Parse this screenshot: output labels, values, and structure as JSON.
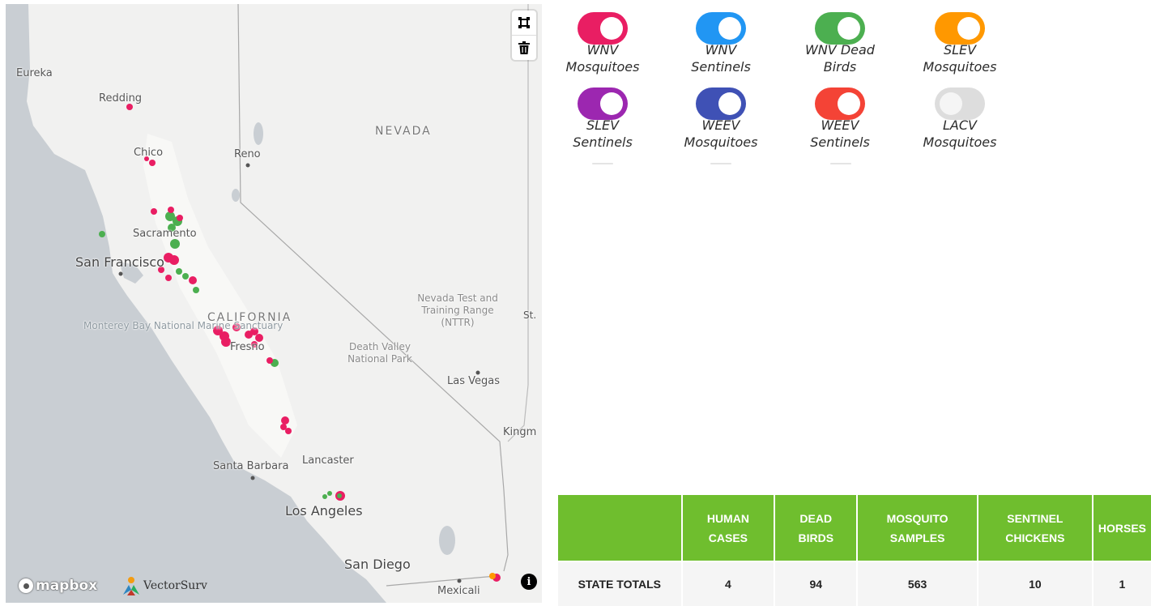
{
  "map": {
    "places": {
      "eureka": "Eureka",
      "redding": "Redding",
      "chico": "Chico",
      "reno": "Reno",
      "nevada": "NEVADA",
      "sacramento": "Sacramento",
      "san_francisco": "San Francisco",
      "california": "CALIFORNIA",
      "fresno": "Fresno",
      "monterey": "Monterey Bay National Marine Sanctuary",
      "nevada_test": "Nevada Test and Training Range (NTTR)",
      "st": "St.",
      "death_valley": "Death Valley National Park",
      "las_vegas": "Las Vegas",
      "kingman": "Kingm",
      "santa_barbara": "Santa Barbara",
      "lancaster": "Lancaster",
      "los_angeles": "Los Angeles",
      "san_diego": "San Diego",
      "mexicali": "Mexicali"
    },
    "attribution": {
      "mapbox": "mapbox",
      "vectorsurv": "VectorSurv"
    },
    "controls": {
      "polygon": "polygon-draw-icon",
      "trash": "trash-icon",
      "info": "i"
    },
    "colors": {
      "wnv_mosquito": "#e91e63",
      "dead_bird": "#4caf50",
      "slev_mosquito": "#ff9800"
    }
  },
  "layers": [
    {
      "line1": "WNV",
      "line2": "Mosquitoes",
      "color": "#e91e63",
      "on": true
    },
    {
      "line1": "WNV",
      "line2": "Sentinels",
      "color": "#2196f3",
      "on": true
    },
    {
      "line1": "WNV Dead",
      "line2": "Birds",
      "color": "#4caf50",
      "on": true
    },
    {
      "line1": "SLEV",
      "line2": "Mosquitoes",
      "color": "#ff9800",
      "on": true
    },
    {
      "line1": "SLEV",
      "line2": "Sentinels",
      "color": "#9c27b0",
      "on": true
    },
    {
      "line1": "WEEV",
      "line2": "Mosquitoes",
      "color": "#3f51b5",
      "on": true
    },
    {
      "line1": "WEEV",
      "line2": "Sentinels",
      "color": "#f44336",
      "on": true
    },
    {
      "line1": "LACV",
      "line2": "Mosquitoes",
      "color": "#dddddd",
      "on": false
    }
  ],
  "totals": {
    "headers": [
      {
        "line1": "",
        "line2": ""
      },
      {
        "line1": "HUMAN",
        "line2": "CASES"
      },
      {
        "line1": "DEAD",
        "line2": "BIRDS"
      },
      {
        "line1": "MOSQUITO",
        "line2": "SAMPLES"
      },
      {
        "line1": "SENTINEL",
        "line2": "CHICKENS"
      },
      {
        "line1": "",
        "line2": "HORSES"
      }
    ],
    "row_label": "STATE TOTALS",
    "values": [
      "4",
      "94",
      "563",
      "10",
      "1"
    ],
    "header_color": "#6fbe2e"
  }
}
